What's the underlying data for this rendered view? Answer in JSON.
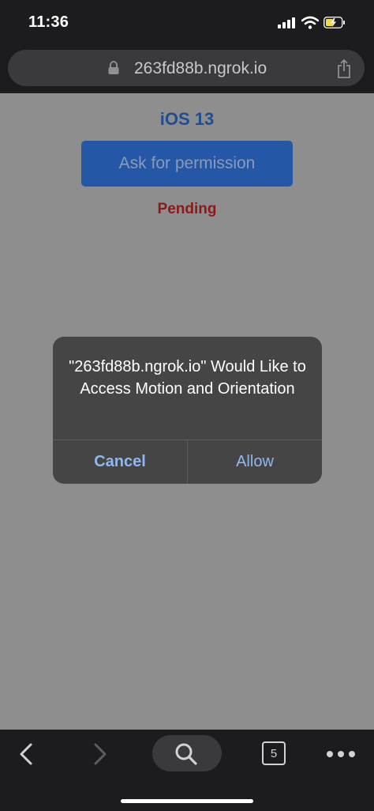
{
  "status_bar": {
    "time": "11:36"
  },
  "browser": {
    "url": "263fd88b.ngrok.io"
  },
  "page": {
    "title": "iOS 13",
    "button_label": "Ask for permission",
    "status": "Pending"
  },
  "alert": {
    "message": "\"263fd88b.ngrok.io\" Would Like to Access Motion and Orientation",
    "cancel_label": "Cancel",
    "allow_label": "Allow"
  },
  "toolbar": {
    "tab_count": "5"
  },
  "colors": {
    "title": "#1f4d8f",
    "button_bg": "#2557a7",
    "status_pending": "#8b1a1a",
    "alert_button_text": "#8fb8f0"
  },
  "icons": [
    "lock-icon",
    "share-icon",
    "back-icon",
    "forward-icon",
    "search-icon",
    "tabs-icon",
    "more-icon",
    "signal-icon",
    "wifi-icon",
    "battery-icon"
  ]
}
